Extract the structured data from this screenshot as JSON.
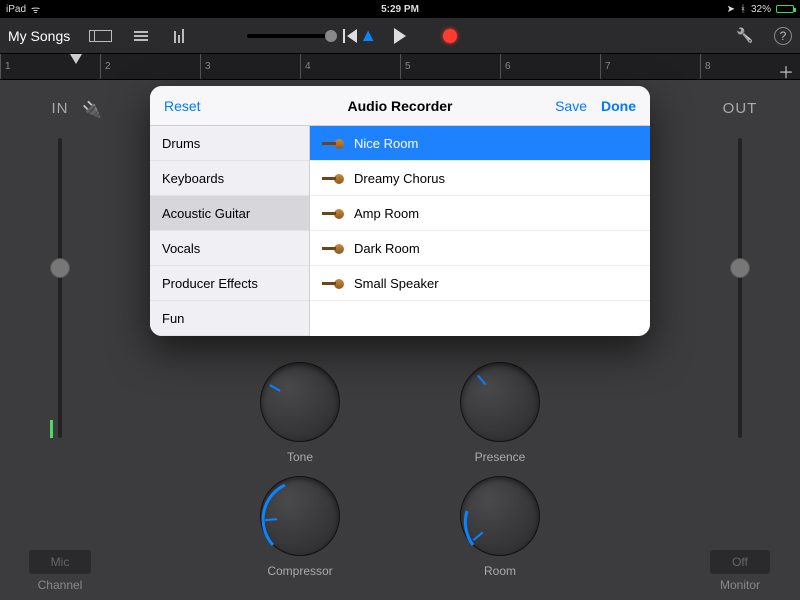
{
  "status": {
    "device": "iPad",
    "time": "5:29 PM",
    "battery_pct": "32%"
  },
  "toolbar": {
    "back": "My Songs"
  },
  "ruler": {
    "marks": [
      "1",
      "2",
      "3",
      "4",
      "5",
      "6",
      "7",
      "8"
    ]
  },
  "io": {
    "in_label": "IN",
    "out_label": "OUT",
    "mic_btn": "Mic",
    "channel_label": "Channel",
    "off_btn": "Off",
    "monitor_label": "Monitor"
  },
  "knobs": {
    "tone": "Tone",
    "presence": "Presence",
    "compressor": "Compressor",
    "room": "Room"
  },
  "modal": {
    "title": "Audio Recorder",
    "reset": "Reset",
    "save": "Save",
    "done": "Done",
    "categories": [
      "Drums",
      "Keyboards",
      "Acoustic Guitar",
      "Vocals",
      "Producer Effects",
      "Fun"
    ],
    "selected_category": "Acoustic Guitar",
    "presets": [
      "Nice Room",
      "Dreamy Chorus",
      "Amp Room",
      "Dark Room",
      "Small Speaker"
    ],
    "selected_preset": "Nice Room"
  }
}
